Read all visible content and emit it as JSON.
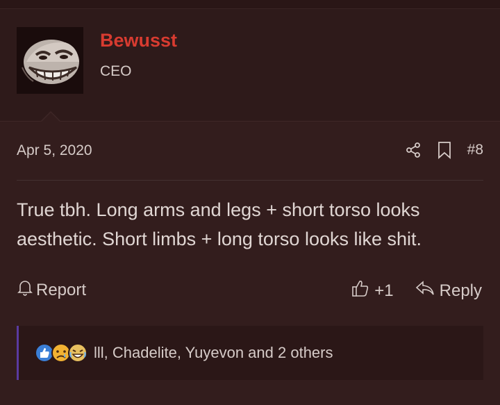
{
  "user": {
    "name": "Bewusst",
    "title": "CEO",
    "avatar_alt": "trollface-avatar"
  },
  "post": {
    "date": "Apr 5, 2020",
    "number": "#8",
    "message": "True tbh. Long arms and legs + short torso looks aesthetic. Short limbs + long torso looks like shit."
  },
  "actions": {
    "report": "Report",
    "like_count": "+1",
    "reply": "Reply"
  },
  "reactions": {
    "icons": [
      "like-reaction-icon",
      "sad-reaction-icon",
      "laugh-reaction-icon"
    ],
    "users_text": "lll, Chadelite, Yuyevon and 2 others"
  },
  "colors": {
    "username": "#d83b30",
    "background": "#2e1a1a",
    "post_background": "#331d1d",
    "reaction_accent": "#5a3aa0"
  }
}
